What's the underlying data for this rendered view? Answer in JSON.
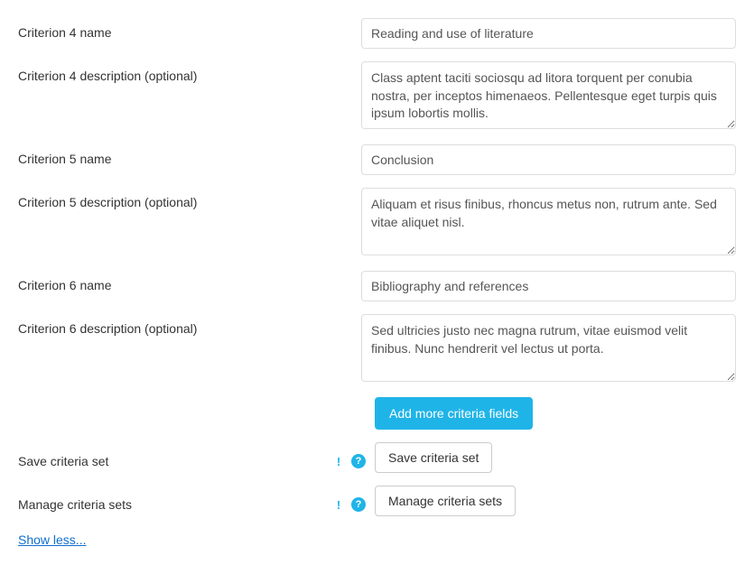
{
  "criteria": [
    {
      "nameLabel": "Criterion 4 name",
      "nameValue": "Reading and use of literature",
      "descLabel": "Criterion 4 description (optional)",
      "descValue": "Class aptent taciti sociosqu ad litora torquent per conubia nostra, per inceptos himenaeos. Pellentesque eget turpis quis ipsum lobortis mollis."
    },
    {
      "nameLabel": "Criterion 5 name",
      "nameValue": "Conclusion",
      "descLabel": "Criterion 5 description (optional)",
      "descValue": "Aliquam et risus finibus, rhoncus metus non, rutrum ante. Sed vitae aliquet nisl."
    },
    {
      "nameLabel": "Criterion 6 name",
      "nameValue": "Bibliography and references",
      "descLabel": "Criterion 6 description (optional)",
      "descValue": "Sed ultricies justo nec magna rutrum, vitae euismod velit finibus. Nunc hendrerit vel lectus ut porta."
    }
  ],
  "buttons": {
    "addMore": "Add more criteria fields",
    "saveSet": "Save criteria set",
    "manageSets": "Manage criteria sets"
  },
  "labels": {
    "saveCriteriaSet": "Save criteria set",
    "manageCriteriaSets": "Manage criteria sets"
  },
  "links": {
    "showLess": "Show less..."
  }
}
